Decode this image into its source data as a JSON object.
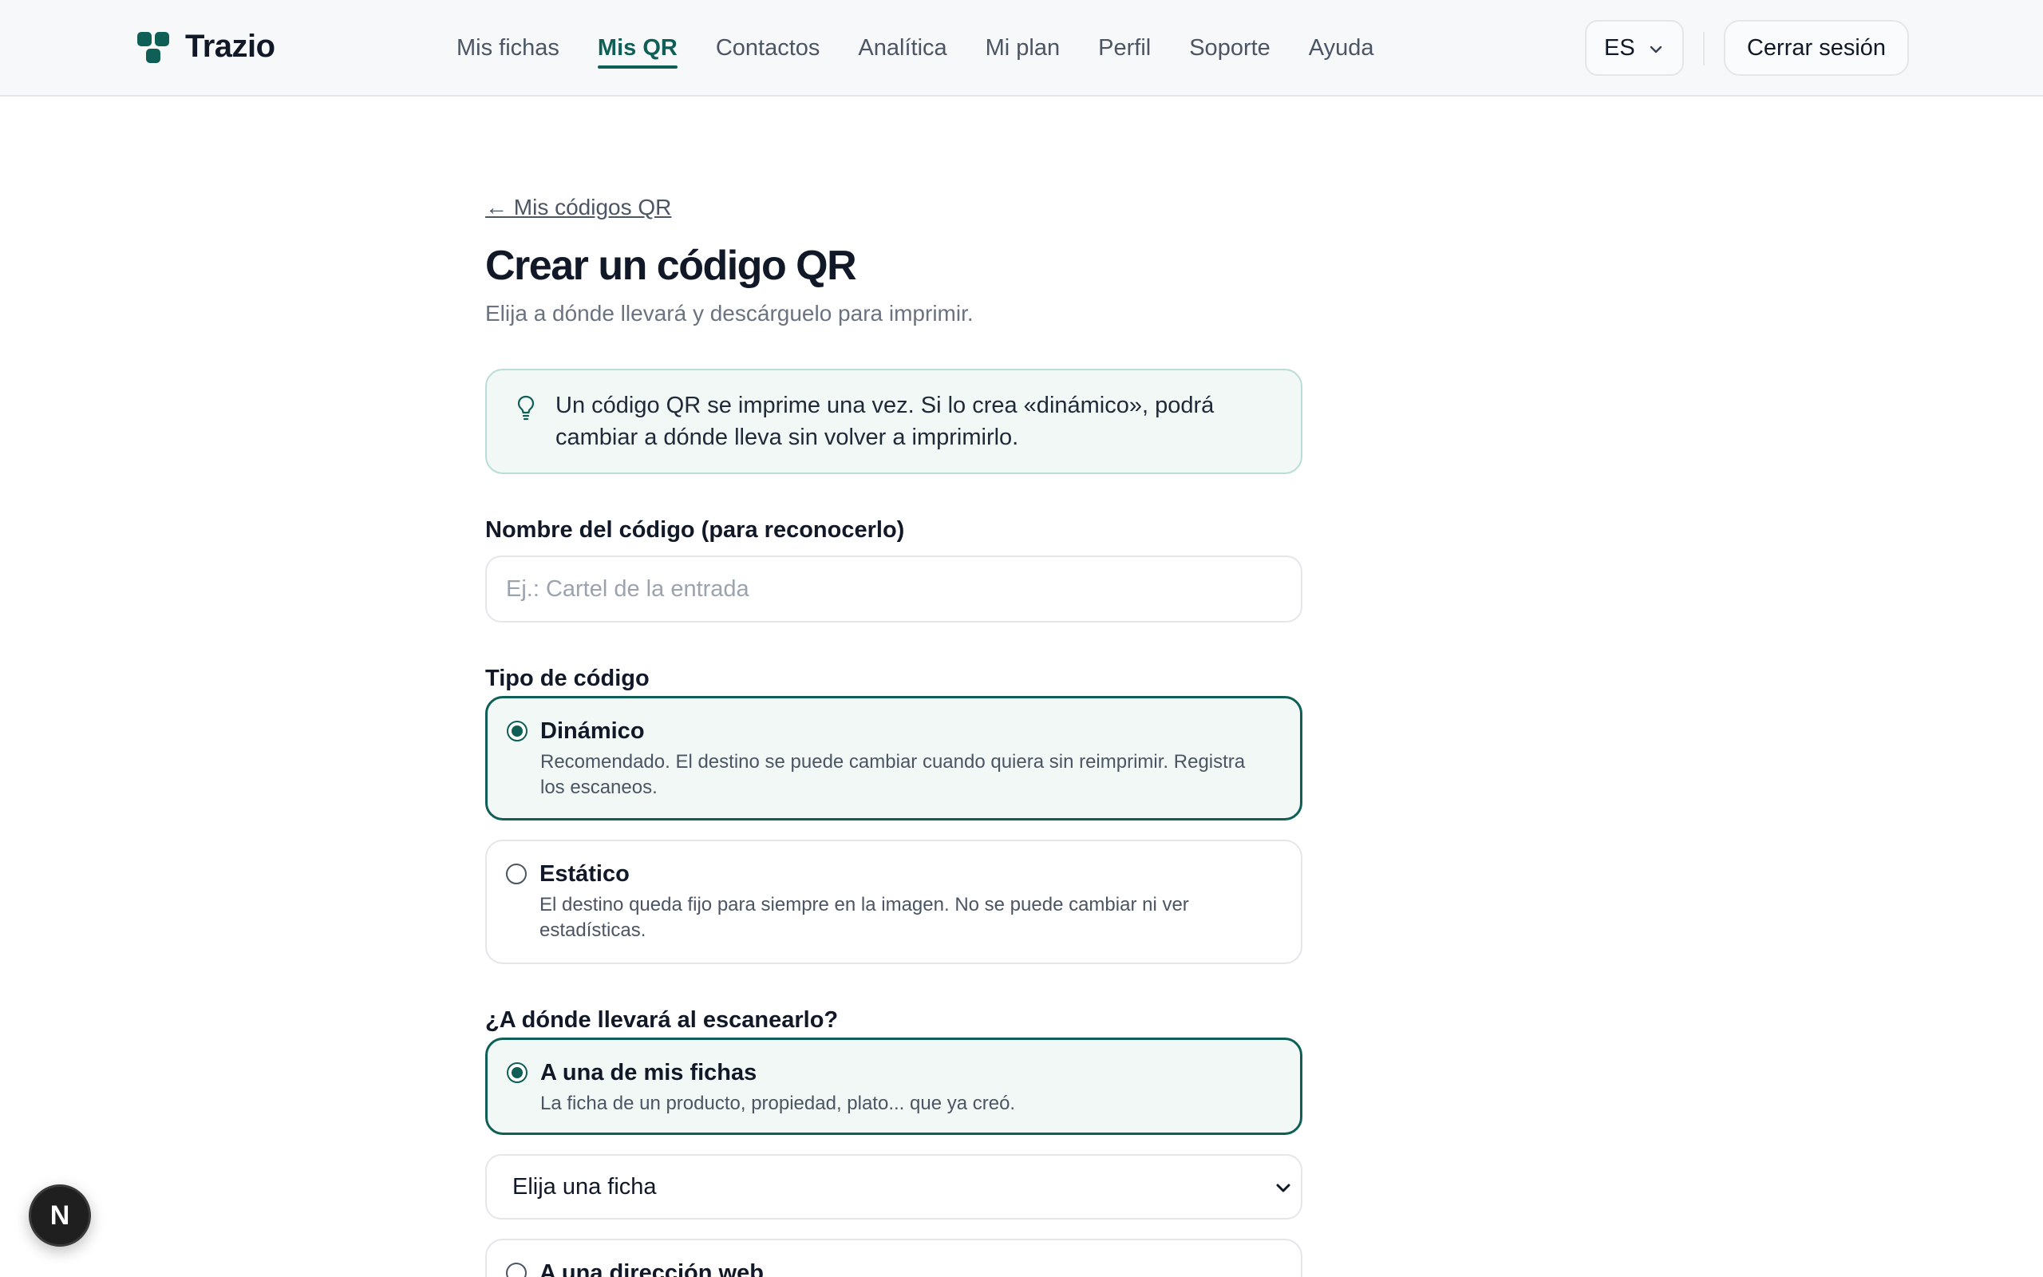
{
  "header": {
    "brand": "Trazio",
    "nav": [
      {
        "label": "Mis fichas",
        "active": false
      },
      {
        "label": "Mis QR",
        "active": true
      },
      {
        "label": "Contactos",
        "active": false
      },
      {
        "label": "Analítica",
        "active": false
      },
      {
        "label": "Mi plan",
        "active": false
      },
      {
        "label": "Perfil",
        "active": false
      },
      {
        "label": "Soporte",
        "active": false
      },
      {
        "label": "Ayuda",
        "active": false
      }
    ],
    "language": "ES",
    "logout": "Cerrar sesión"
  },
  "main": {
    "back_link": "← Mis códigos QR",
    "title": "Crear un código QR",
    "subtitle": "Elija a dónde llevará y descárguelo para imprimir.",
    "info": "Un código QR se imprime una vez. Si lo crea «dinámico», podrá cambiar a dónde lleva sin volver a imprimirlo.",
    "name_field": {
      "label": "Nombre del código (para reconocerlo)",
      "placeholder": "Ej.: Cartel de la entrada",
      "value": ""
    },
    "type": {
      "label": "Tipo de código",
      "options": [
        {
          "title": "Dinámico",
          "desc": "Recomendado. El destino se puede cambiar cuando quiera sin reimprimir. Registra los escaneos.",
          "selected": true
        },
        {
          "title": "Estático",
          "desc": "El destino queda fijo para siempre en la imagen. No se puede cambiar ni ver estadísticas.",
          "selected": false
        }
      ]
    },
    "destination": {
      "label": "¿A dónde llevará al escanearlo?",
      "options": [
        {
          "title": "A una de mis fichas",
          "desc": "La ficha de un producto, propiedad, plato... que ya creó.",
          "selected": true
        },
        {
          "title": "A una dirección web",
          "desc": "",
          "selected": false
        }
      ],
      "select_value": "Elija una ficha"
    }
  },
  "fab_letter": "N",
  "colors": {
    "accent": "#0f5f57",
    "info_bg": "#f1f8f6",
    "info_border": "#b9ddd6",
    "header_bg": "#f7f8f9"
  }
}
